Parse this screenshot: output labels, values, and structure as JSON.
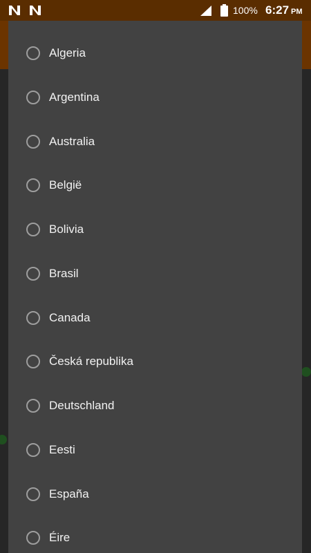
{
  "status_bar": {
    "battery": "100%",
    "time": "6:27",
    "ampm": "PM"
  },
  "dialog": {
    "options": [
      {
        "label": "Algeria"
      },
      {
        "label": "Argentina"
      },
      {
        "label": "Australia"
      },
      {
        "label": "België"
      },
      {
        "label": "Bolivia"
      },
      {
        "label": "Brasil"
      },
      {
        "label": "Canada"
      },
      {
        "label": "Česká republika"
      },
      {
        "label": "Deutschland"
      },
      {
        "label": "Eesti"
      },
      {
        "label": "España"
      },
      {
        "label": "Éire"
      }
    ]
  }
}
